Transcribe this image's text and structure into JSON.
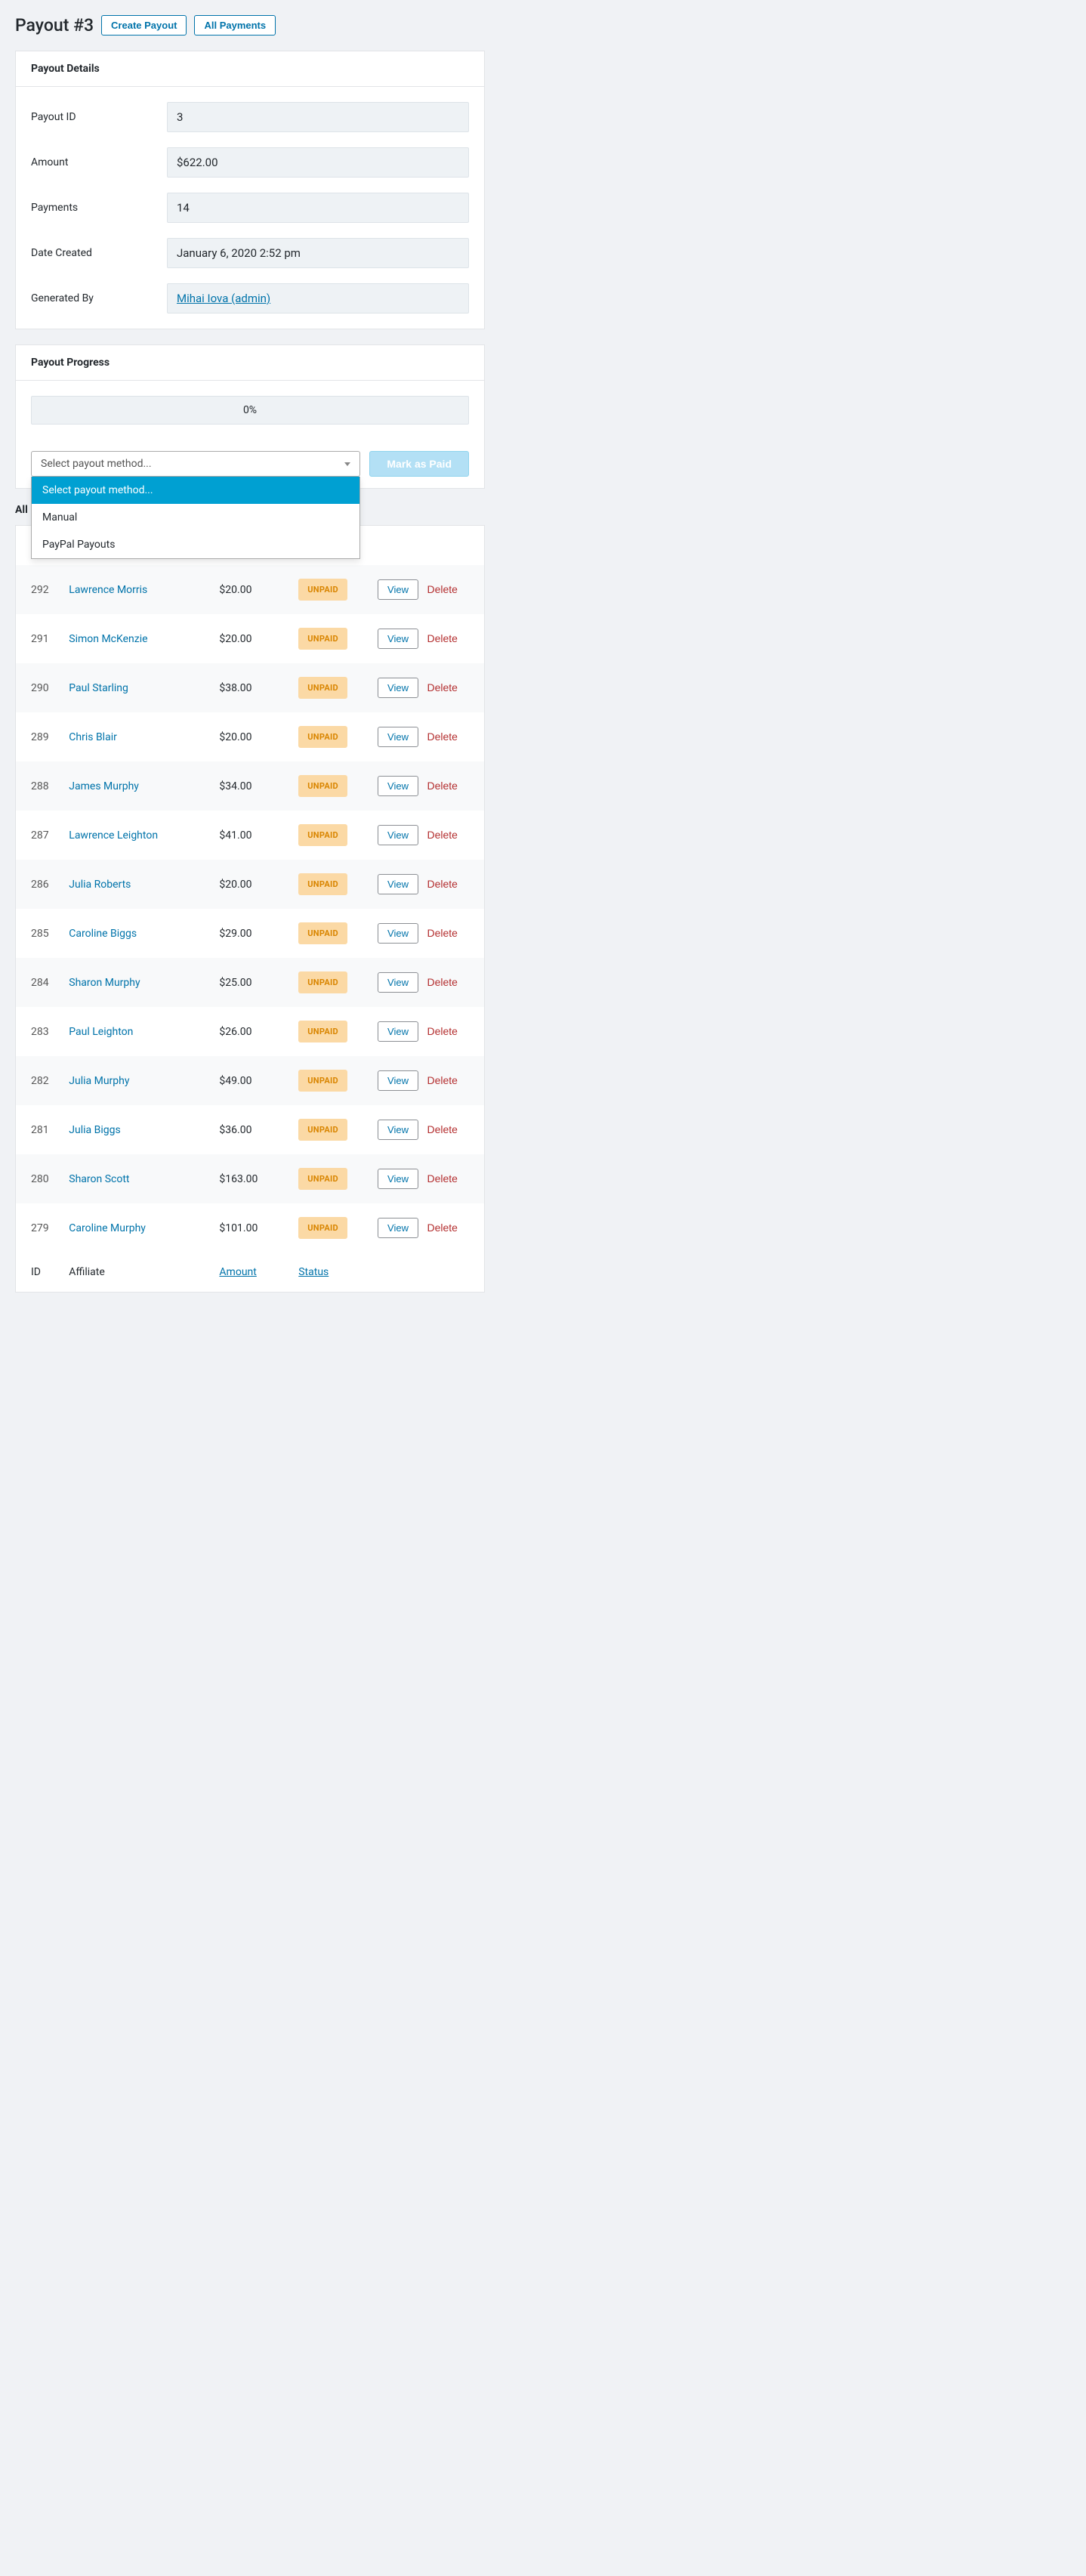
{
  "header": {
    "title": "Payout #3",
    "create_btn": "Create Payout",
    "all_payments_btn": "All Payments"
  },
  "details": {
    "card_title": "Payout Details",
    "labels": {
      "payout_id": "Payout ID",
      "amount": "Amount",
      "payments": "Payments",
      "date_created": "Date Created",
      "generated_by": "Generated By"
    },
    "values": {
      "payout_id": "3",
      "amount": "$622.00",
      "payments": "14",
      "date_created": "January 6, 2020 2:52 pm",
      "generated_by": "Mihai Iova (admin)"
    }
  },
  "progress": {
    "card_title": "Payout Progress",
    "percent": "0%",
    "select_placeholder": "Select payout method...",
    "dropdown": {
      "placeholder": "Select payout method...",
      "manual": "Manual",
      "paypal": "PayPal Payouts"
    },
    "mark_paid_btn": "Mark as Paid"
  },
  "payments_section": {
    "title_prefix": "All",
    "columns": {
      "id": "ID",
      "affiliate": "Affiliate",
      "amount": "Amount",
      "status": "Status"
    },
    "view_btn": "View",
    "delete_btn": "Delete",
    "rows": [
      {
        "id": "292",
        "affiliate": "Lawrence Morris",
        "amount": "$20.00",
        "status": "UNPAID"
      },
      {
        "id": "291",
        "affiliate": "Simon McKenzie",
        "amount": "$20.00",
        "status": "UNPAID"
      },
      {
        "id": "290",
        "affiliate": "Paul Starling",
        "amount": "$38.00",
        "status": "UNPAID"
      },
      {
        "id": "289",
        "affiliate": "Chris Blair",
        "amount": "$20.00",
        "status": "UNPAID"
      },
      {
        "id": "288",
        "affiliate": "James Murphy",
        "amount": "$34.00",
        "status": "UNPAID"
      },
      {
        "id": "287",
        "affiliate": "Lawrence Leighton",
        "amount": "$41.00",
        "status": "UNPAID"
      },
      {
        "id": "286",
        "affiliate": "Julia Roberts",
        "amount": "$20.00",
        "status": "UNPAID"
      },
      {
        "id": "285",
        "affiliate": "Caroline Biggs",
        "amount": "$29.00",
        "status": "UNPAID"
      },
      {
        "id": "284",
        "affiliate": "Sharon Murphy",
        "amount": "$25.00",
        "status": "UNPAID"
      },
      {
        "id": "283",
        "affiliate": "Paul Leighton",
        "amount": "$26.00",
        "status": "UNPAID"
      },
      {
        "id": "282",
        "affiliate": "Julia Murphy",
        "amount": "$49.00",
        "status": "UNPAID"
      },
      {
        "id": "281",
        "affiliate": "Julia Biggs",
        "amount": "$36.00",
        "status": "UNPAID"
      },
      {
        "id": "280",
        "affiliate": "Sharon Scott",
        "amount": "$163.00",
        "status": "UNPAID"
      },
      {
        "id": "279",
        "affiliate": "Caroline Murphy",
        "amount": "$101.00",
        "status": "UNPAID"
      }
    ]
  }
}
